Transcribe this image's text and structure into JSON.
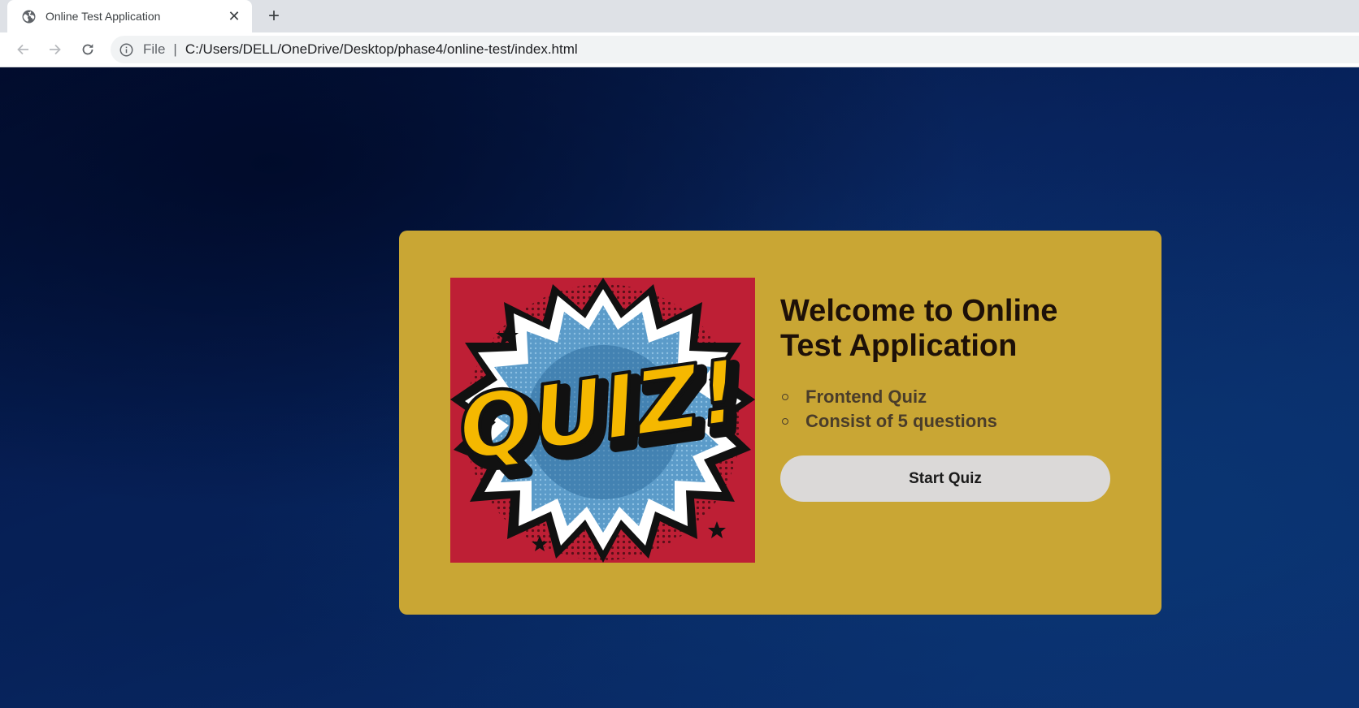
{
  "browser": {
    "tab": {
      "title": "Online Test Application",
      "favicon": "globe-icon",
      "close_glyph": "✕"
    },
    "new_tab_glyph": "+",
    "toolbar": {
      "back_icon": "back-arrow-icon",
      "forward_icon": "forward-arrow-icon",
      "reload_icon": "reload-icon",
      "site_info_icon": "info-icon",
      "scheme_label": "File",
      "separator": "|",
      "url": "C:/Users/DELL/OneDrive/Desktop/phase4/online-test/index.html"
    }
  },
  "page": {
    "card": {
      "image": {
        "text": "QUIZ!",
        "background_color": "#be1f35",
        "letter_color": "#f5b800"
      },
      "title": "Welcome to Online Test Application",
      "features": [
        "Frontend Quiz",
        "Consist of 5 questions"
      ],
      "start_button": "Start Quiz"
    },
    "colors": {
      "card": "#c9a634",
      "button": "#dbd9d8",
      "background": "#0a2c6a"
    }
  }
}
